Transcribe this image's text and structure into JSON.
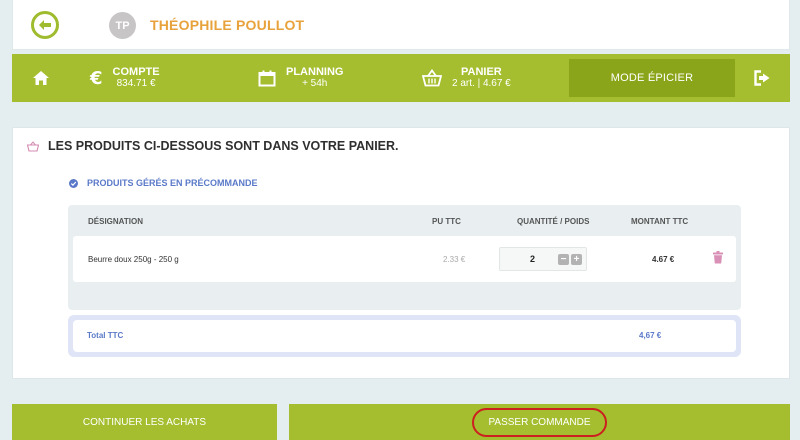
{
  "header": {
    "avatar_initials": "TP",
    "user_name": "THÉOPHILE POULLOT"
  },
  "nav": {
    "compte_label": "COMPTE",
    "compte_value": "834.71 €",
    "planning_label": "PLANNING",
    "planning_value": "+ 54h",
    "panier_label": "PANIER",
    "panier_value": "2 art. | 4.67 €",
    "mode_label": "MODE ÉPICIER"
  },
  "cart": {
    "title": "LES PRODUITS CI-DESSOUS SONT DANS VOTRE PANIER.",
    "section_label": "PRODUITS GÉRÉS EN PRÉCOMMANDE",
    "columns": {
      "designation": "DÉSIGNATION",
      "pu": "PU TTC",
      "qty": "QUANTITÉ / POIDS",
      "amount": "MONTANT TTC"
    },
    "items": [
      {
        "designation": "Beurre doux 250g - 250 g",
        "pu": "2.33 €",
        "qty": "2",
        "amount": "4.67 €"
      }
    ],
    "total_label": "Total TTC",
    "total_value": "4,67 €"
  },
  "actions": {
    "continue_label": "CONTINUER LES ACHATS",
    "order_label": "PASSER COMMANDE"
  },
  "colors": {
    "brand_green": "#a5be2f",
    "accent_orange": "#e8a23c",
    "link_blue": "#5a79c8",
    "highlight_red": "#cc1f1f"
  }
}
